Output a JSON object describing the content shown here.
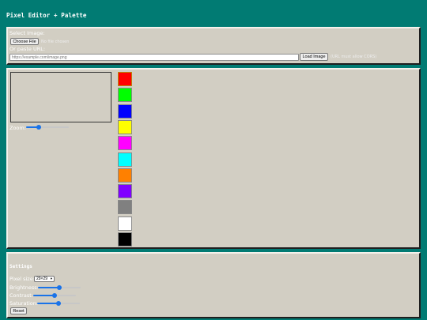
{
  "app": {
    "title": "Pixel Editor + Palette"
  },
  "load": {
    "select_label": "Select Image:",
    "choose_file_button": "Choose File",
    "file_status": "No file chosen",
    "url_label": "Or paste URL:",
    "url_value": "",
    "url_placeholder": "https://example.com/image.png",
    "load_button": "Load Image",
    "cors_note": "(URL must allow CORS)"
  },
  "editor": {
    "zoom_label": "Zoom:",
    "zoom_value": 0.3
  },
  "palette": {
    "selected_index": 0,
    "colors": [
      "#ff0000",
      "#00ff00",
      "#0000ff",
      "#ffff00",
      "#ff00ff",
      "#00ffff",
      "#ff8000",
      "#8000ff",
      "#808080",
      "#ffffff",
      "#000000"
    ]
  },
  "settings": {
    "title": "Settings",
    "pixel_size_label": "Pixel size:",
    "pixel_size_value": "29×29",
    "brightness_label": "Brightness:",
    "brightness_value": 0.5,
    "contrast_label": "Contrast:",
    "contrast_value": 0.5,
    "saturation_label": "Saturation:",
    "saturation_value": 0.5,
    "reset_button": "Reset"
  }
}
